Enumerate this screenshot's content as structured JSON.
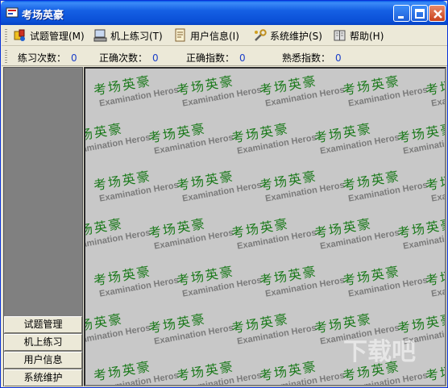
{
  "window": {
    "title": "考场英豪"
  },
  "menu": [
    {
      "label": "试题管理(M)",
      "icon": "exam-manage-icon"
    },
    {
      "label": "机上练习(T)",
      "icon": "computer-practice-icon"
    },
    {
      "label": "用户信息(I)",
      "icon": "user-info-icon"
    },
    {
      "label": "系统维护(S)",
      "icon": "system-maintenance-icon"
    },
    {
      "label": "帮助(H)",
      "icon": "help-book-icon"
    }
  ],
  "stats": [
    {
      "label": "练习次数：",
      "value": "0"
    },
    {
      "label": "正确次数：",
      "value": "0"
    },
    {
      "label": "正确指数：",
      "value": "0"
    },
    {
      "label": "熟悉指数：",
      "value": "0"
    }
  ],
  "nav": [
    {
      "label": "试题管理"
    },
    {
      "label": "机上练习"
    },
    {
      "label": "用户信息"
    },
    {
      "label": "系统维护"
    }
  ],
  "watermark": {
    "cn": "考场英豪",
    "en": "Examination Heros"
  },
  "colors": {
    "titlebar": "#0a4fd6",
    "watermark_cn": "#1c7a1c",
    "stat_value": "#1a3ec8",
    "left_pane": "#808080",
    "main_bg": "#c8c8c8"
  }
}
